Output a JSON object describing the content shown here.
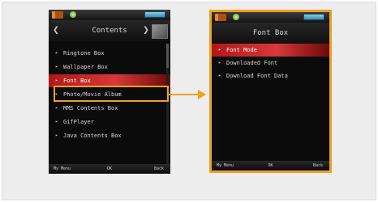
{
  "colors": {
    "highlight": "#f0a020",
    "selection": "#c02020",
    "screen_bg": "#0b0b0b"
  },
  "left_screen": {
    "title": "Contents",
    "items": [
      {
        "label": "Ringtone Box"
      },
      {
        "label": "Wallpaper Box"
      },
      {
        "label": "Font Box"
      },
      {
        "label": "Photo/Movie Album"
      },
      {
        "label": "MMS Contents Box"
      },
      {
        "label": "GifPlayer"
      },
      {
        "label": "Java Contents Box"
      }
    ],
    "selected_index": 2,
    "softkeys": {
      "left": "My Menu",
      "center": "OK",
      "right": "Back"
    }
  },
  "right_screen": {
    "title": "Font Box",
    "items": [
      {
        "label": "Font Mode"
      },
      {
        "label": "Downloaded Font"
      },
      {
        "label": "Download Font Data"
      }
    ],
    "selected_index": 0,
    "softkeys": {
      "left": "My Menu",
      "center": "OK",
      "right": "Back"
    }
  }
}
